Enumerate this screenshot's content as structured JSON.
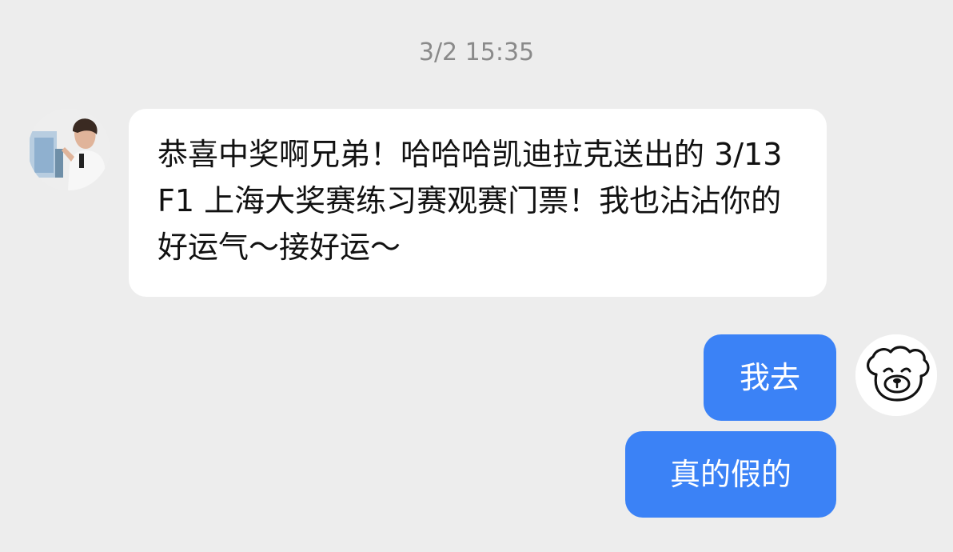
{
  "chat": {
    "timestamp": "3/2 15:35",
    "messages": [
      {
        "sender": "other",
        "text": "恭喜中奖啊兄弟！哈哈哈凯迪拉克送出的 3/13 F1 上海大奖赛练习赛观赛门票！我也沾沾你的好运气～接好运～"
      },
      {
        "sender": "self",
        "text": "我去"
      },
      {
        "sender": "self",
        "text": "真的假的"
      }
    ]
  },
  "icons": {
    "left_avatar": "contact-photo-avatar",
    "right_avatar": "cartoon-bear-face-icon"
  },
  "colors": {
    "background": "#ededed",
    "incoming_bubble": "#ffffff",
    "outgoing_bubble": "#3b82f6",
    "timestamp_text": "#8a8a8a"
  }
}
